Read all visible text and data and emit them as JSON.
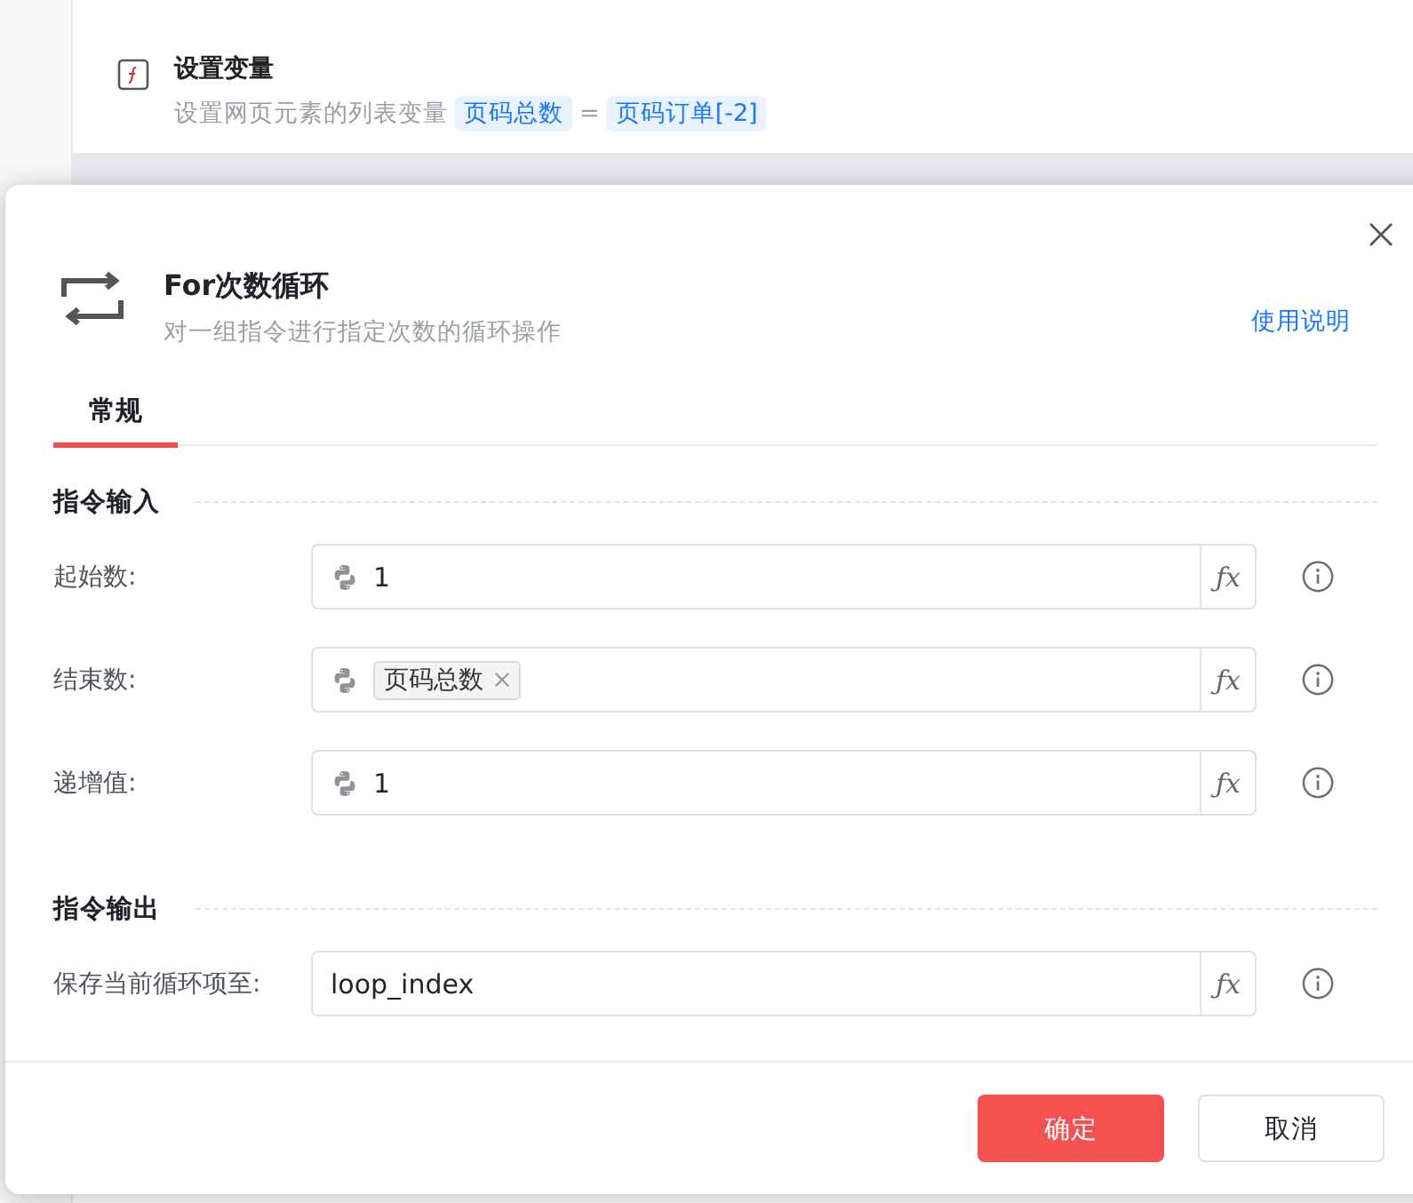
{
  "background": {
    "items": [
      {
        "title": "设置变量",
        "description": "设置网页元素的列表变量",
        "parts": [
          {
            "kind": "tag",
            "text": "页码总数"
          },
          {
            "kind": "text",
            "text": "="
          },
          {
            "kind": "tag",
            "text": "页码订单[-2]"
          }
        ]
      }
    ]
  },
  "dialog": {
    "title": "For次数循环",
    "description": "对一组指令进行指定次数的循环操作",
    "help_link": "使用说明",
    "tabs": [
      {
        "label": "常规",
        "selected": true
      }
    ],
    "sections": [
      {
        "title": "指令输入",
        "fields": [
          {
            "label": "起始数:",
            "kind": "python",
            "value": "1",
            "formula": "ƒx"
          },
          {
            "label": "结束数:",
            "kind": "python",
            "tags": [
              "页码总数"
            ],
            "formula": "ƒx"
          },
          {
            "label": "递增值:",
            "kind": "python",
            "value": "1",
            "formula": "ƒx"
          }
        ]
      },
      {
        "title": "指令输出",
        "fields": [
          {
            "label": "保存当前循环项至:",
            "kind": "plain",
            "value": "loop_index",
            "formula": "ƒx"
          }
        ]
      }
    ],
    "buttons": [
      {
        "label": "确定",
        "kind": "primary"
      },
      {
        "label": "取消",
        "kind": "default"
      }
    ]
  }
}
